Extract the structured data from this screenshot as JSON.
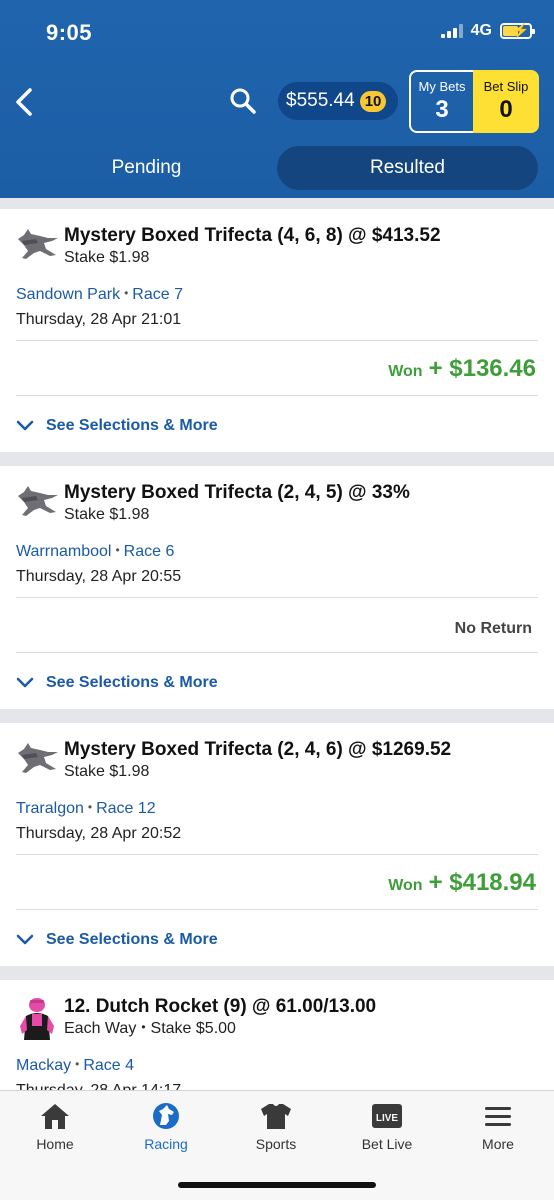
{
  "status_bar": {
    "time": "9:05",
    "network": "4G"
  },
  "header": {
    "balance": "$555.44",
    "balance_badge": "10",
    "my_bets_label": "My Bets",
    "my_bets_count": "3",
    "bet_slip_label": "Bet Slip",
    "bet_slip_count": "0",
    "tabs": [
      {
        "label": "Pending",
        "active": false
      },
      {
        "label": "Resulted",
        "active": true
      }
    ]
  },
  "bets": [
    {
      "title": "Mystery Boxed Trifecta (4, 6, 8) @ $413.52",
      "subtitle": "Stake $1.98",
      "venue": "Sandown Park",
      "race": "Race 7",
      "datetime": "Thursday, 28 Apr 21:01",
      "result_label": "Won",
      "result_amount": "+ $136.46",
      "see_more": "See Selections & More"
    },
    {
      "title": "Mystery Boxed Trifecta (2, 4, 5) @ 33%",
      "subtitle": "Stake $1.98",
      "venue": "Warrnambool",
      "race": "Race 6",
      "datetime": "Thursday, 28 Apr 20:55",
      "result_text": "No Return",
      "see_more": "See Selections & More"
    },
    {
      "title": "Mystery Boxed Trifecta (2, 4, 6) @ $1269.52",
      "subtitle": "Stake $1.98",
      "venue": "Traralgon",
      "race": "Race 12",
      "datetime": "Thursday, 28 Apr 20:52",
      "result_label": "Won",
      "result_amount": "+ $418.94",
      "see_more": "See Selections & More"
    },
    {
      "title": "12. Dutch Rocket (9) @ 61.00/13.00",
      "subtitle_type": "Each Way",
      "subtitle_stake": "Stake $5.00",
      "venue": "Mackay",
      "race": "Race 4",
      "datetime": "Thursday, 28 Apr 14:17"
    }
  ],
  "nav": [
    {
      "label": "Home",
      "icon": "home-icon",
      "active": false
    },
    {
      "label": "Racing",
      "icon": "racing-horse-icon",
      "active": true
    },
    {
      "label": "Sports",
      "icon": "sports-jersey-icon",
      "active": false
    },
    {
      "label": "Bet Live",
      "icon": "live-icon",
      "active": false,
      "icon_text": "LIVE"
    },
    {
      "label": "More",
      "icon": "menu-icon",
      "active": false
    }
  ],
  "colors": {
    "header_blue": "#1f64ad",
    "accent_yellow": "#fde033",
    "link_blue": "#1a5aa6",
    "won_green": "#3f9d3a"
  }
}
